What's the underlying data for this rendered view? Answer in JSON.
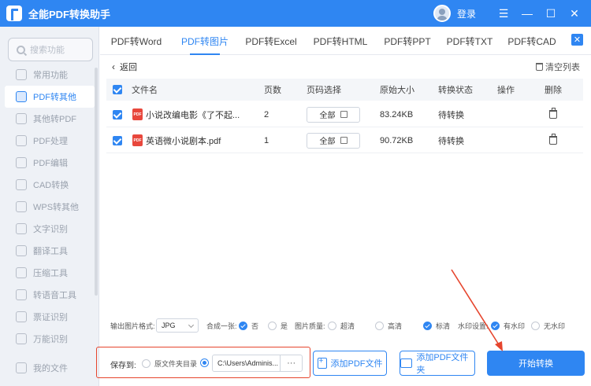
{
  "app": {
    "title": "全能PDF转换助手",
    "login": "登录",
    "accent": "#2f86f2"
  },
  "sidebar": {
    "search_placeholder": "搜索功能",
    "items": [
      {
        "label": "常用功能",
        "active": false
      },
      {
        "label": "PDF转其他",
        "active": true
      },
      {
        "label": "其他转PDF",
        "active": false
      },
      {
        "label": "PDF处理",
        "active": false
      },
      {
        "label": "PDF编辑",
        "active": false
      },
      {
        "label": "CAD转换",
        "active": false
      },
      {
        "label": "WPS转其他",
        "active": false
      },
      {
        "label": "文字识别",
        "active": false
      },
      {
        "label": "翻译工具",
        "active": false
      },
      {
        "label": "压缩工具",
        "active": false
      },
      {
        "label": "转语音工具",
        "active": false
      },
      {
        "label": "票证识别",
        "active": false
      },
      {
        "label": "万能识别",
        "active": false
      }
    ],
    "my_files": "我的文件"
  },
  "tabs": [
    "PDF转Word",
    "PDF转图片",
    "PDF转Excel",
    "PDF转HTML",
    "PDF转PPT",
    "PDF转TXT",
    "PDF转CAD"
  ],
  "active_tab": "PDF转图片",
  "toolbar": {
    "back": "返回",
    "clear": "清空列表"
  },
  "table": {
    "headers": {
      "name": "文件名",
      "pages": "页数",
      "page_select": "页码选择",
      "size": "原始大小",
      "status": "转换状态",
      "action": "操作",
      "delete": "删除"
    },
    "rows": [
      {
        "name": "小说改编电影《了不起...",
        "pages": "2",
        "page_select": "全部",
        "size": "83.24KB",
        "status": "待转换"
      },
      {
        "name": "英语微小说剧本.pdf",
        "pages": "1",
        "page_select": "全部",
        "size": "90.72KB",
        "status": "待转换"
      }
    ]
  },
  "options": {
    "format_label": "输出图片格式:",
    "format_value": "JPG",
    "merge_label": "合成一张:",
    "merge_no": "否",
    "merge_yes": "是",
    "quality_label": "图片质量:",
    "quality_super": "超清",
    "quality_high": "高清",
    "quality_std": "标清",
    "watermark_label": "水印设置:",
    "watermark_on": "有水印",
    "watermark_off": "无水印"
  },
  "bottom": {
    "save_to": "保存到:",
    "source_dir": "原文件夹目录",
    "path": "C:\\Users\\Adminis...",
    "add_file": "添加PDF文件",
    "add_folder": "添加PDF文件夹",
    "start": "开始转换"
  },
  "icons": {
    "pdf_badge": "PDF"
  }
}
